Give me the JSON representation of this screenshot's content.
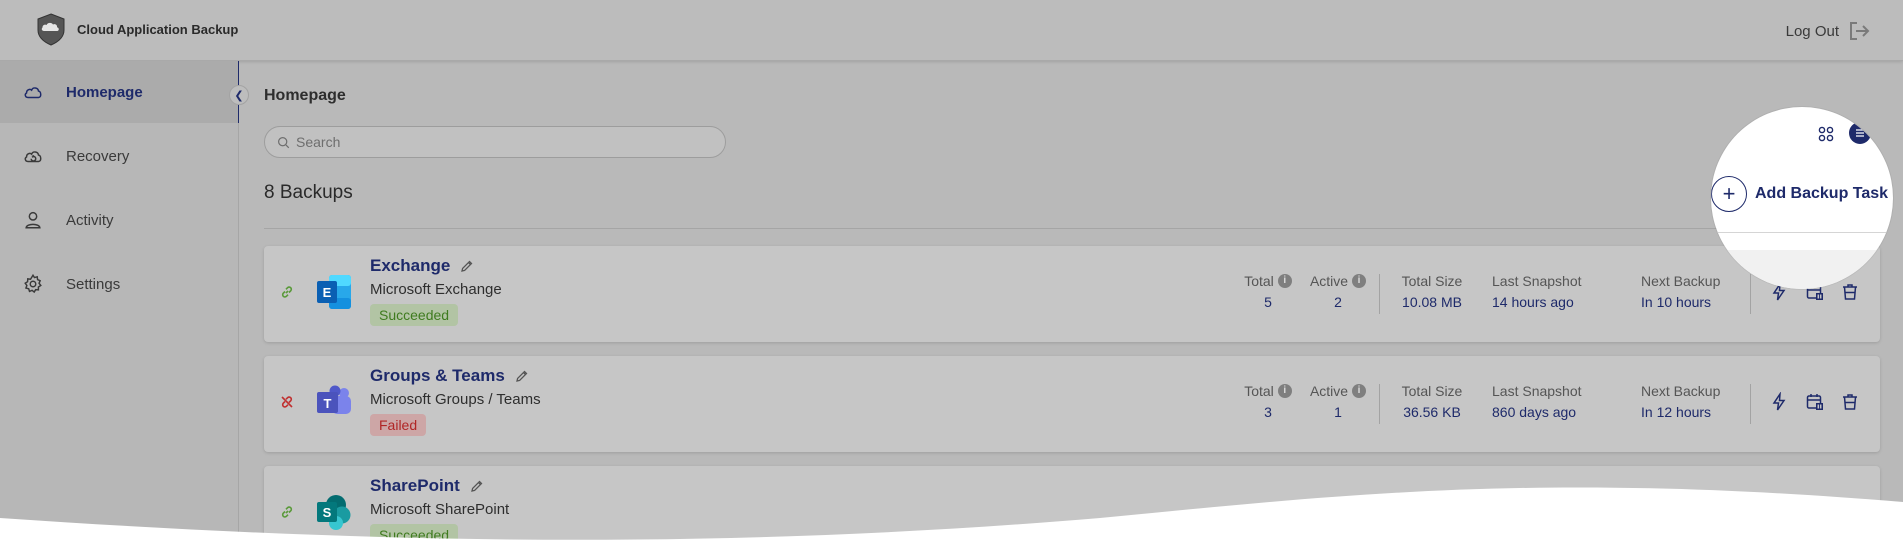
{
  "header": {
    "app_name": "Cloud Application Backup",
    "logout_label": "Log Out"
  },
  "sidebar": {
    "items": [
      {
        "label": "Homepage",
        "icon": "cloud-icon",
        "active": true
      },
      {
        "label": "Recovery",
        "icon": "cloud-recovery-icon",
        "active": false
      },
      {
        "label": "Activity",
        "icon": "user-icon",
        "active": false
      },
      {
        "label": "Settings",
        "icon": "gear-icon",
        "active": false
      }
    ]
  },
  "main": {
    "page_title": "Homepage",
    "search": {
      "placeholder": "Search",
      "value": ""
    },
    "backups_count_label": "8 Backups",
    "add_backup_label": "Add Backup Task",
    "stat_labels": {
      "total": "Total",
      "active": "Active",
      "total_size": "Total Size",
      "last_snapshot": "Last Snapshot",
      "next_backup": "Next Backup"
    },
    "backups": [
      {
        "name": "Exchange",
        "service": "Microsoft Exchange",
        "status": "Succeeded",
        "linked": true,
        "total": "5",
        "active": "2",
        "total_size": "10.08 MB",
        "last_snapshot": "14 hours ago",
        "next_backup": "In 10 hours"
      },
      {
        "name": "Groups & Teams",
        "service": "Microsoft Groups / Teams",
        "status": "Failed",
        "linked": false,
        "total": "3",
        "active": "1",
        "total_size": "36.56 KB",
        "last_snapshot": "860 days ago",
        "next_backup": "In 12 hours"
      },
      {
        "name": "SharePoint",
        "service": "Microsoft SharePoint",
        "status": "Succeeded",
        "linked": true
      }
    ]
  },
  "colors": {
    "accent": "#1e2a6a",
    "success": "#3f7b1f",
    "failure": "#b02626",
    "exchange_blue": "#1f6fc5",
    "teams_purple": "#4b53bc",
    "sharepoint_teal": "#038387"
  }
}
